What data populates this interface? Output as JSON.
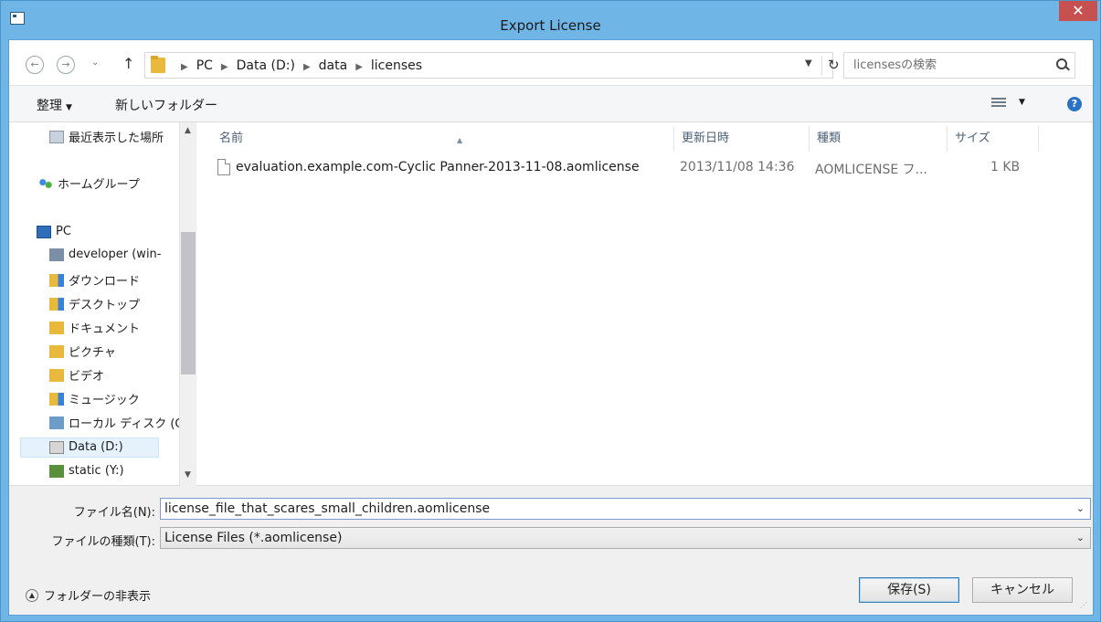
{
  "window": {
    "title": "Export License",
    "close_glyph": "✕"
  },
  "nav": {
    "back_glyph": "←",
    "forward_glyph": "→",
    "history_glyph": "⌄",
    "up_glyph": "↑",
    "breadcrumb": [
      "PC",
      "Data (D:)",
      "data",
      "licenses"
    ],
    "search_placeholder": "licensesの検索"
  },
  "toolbar": {
    "organize_label": "整理",
    "new_folder_label": "新しいフォルダー",
    "help_glyph": "?"
  },
  "sidebar": {
    "items": [
      {
        "label": "最近表示した場所",
        "icon": "recent-places-icon"
      },
      {
        "label": "ホームグループ",
        "icon": "homegroup-icon"
      },
      {
        "label": "PC",
        "icon": "pc-icon"
      },
      {
        "label": "developer (win-",
        "icon": "network-user-icon"
      },
      {
        "label": "ダウンロード",
        "icon": "downloads-folder-icon"
      },
      {
        "label": "デスクトップ",
        "icon": "desktop-folder-icon"
      },
      {
        "label": "ドキュメント",
        "icon": "documents-folder-icon"
      },
      {
        "label": "ピクチャ",
        "icon": "pictures-folder-icon"
      },
      {
        "label": "ビデオ",
        "icon": "videos-folder-icon"
      },
      {
        "label": "ミュージック",
        "icon": "music-folder-icon"
      },
      {
        "label": "ローカル ディスク (C",
        "icon": "local-disk-icon"
      },
      {
        "label": "Data (D:)",
        "icon": "drive-icon",
        "selected": true
      },
      {
        "label": "static (Y:)",
        "icon": "network-drive-icon"
      }
    ]
  },
  "columns": {
    "name": "名前",
    "date": "更新日時",
    "type": "種類",
    "size": "サイズ"
  },
  "files": [
    {
      "name": "evaluation.example.com-Cyclic Panner-2013-11-08.aomlicense",
      "date": "2013/11/08 14:36",
      "type": "AOMLICENSE フ...",
      "size": "1 KB"
    }
  ],
  "form": {
    "filename_label": "ファイル名(N):",
    "filename_value": "license_file_that_scares_small_children.aomlicense",
    "filetype_label": "ファイルの種類(T):",
    "filetype_value": "License Files (*.aomlicense)"
  },
  "footer": {
    "hide_folders_label": "フォルダーの非表示",
    "save_label": "保存(S)",
    "cancel_label": "キャンセル"
  },
  "colors": {
    "titlebar": "#6fb5e6",
    "close": "#c75050",
    "selection": "#e5f1fb"
  }
}
